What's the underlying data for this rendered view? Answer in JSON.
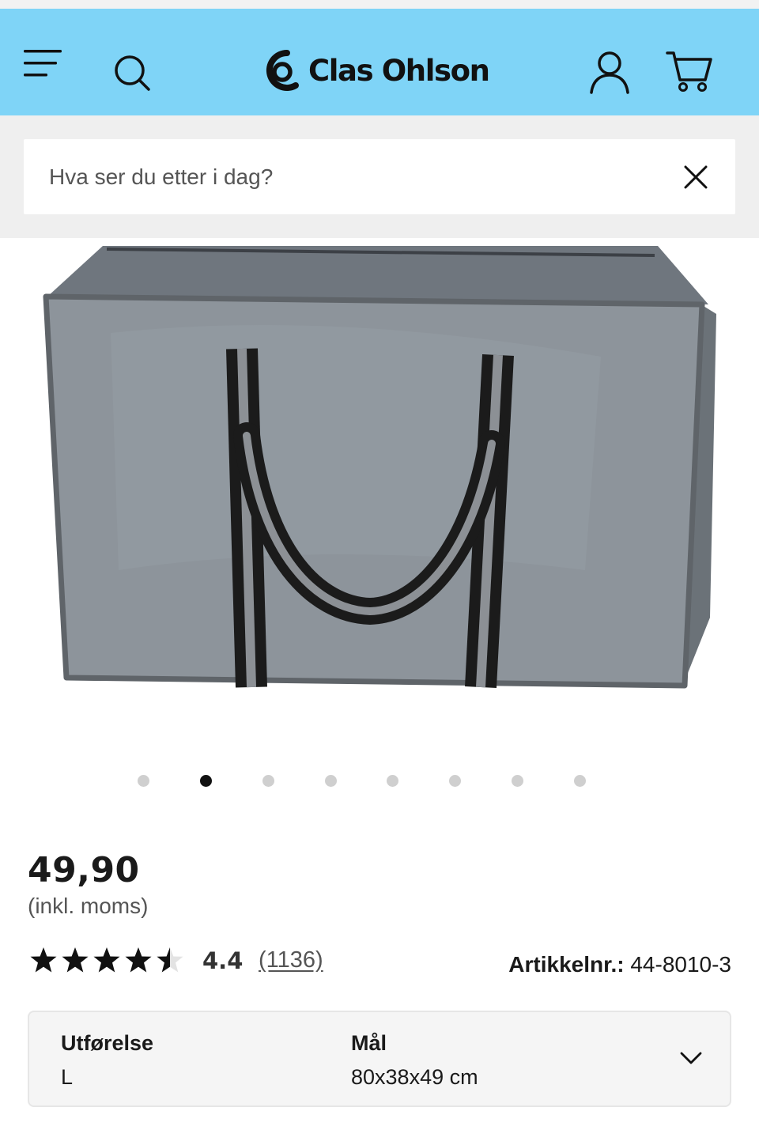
{
  "header": {
    "brand": "Clas Ohlson",
    "icons": [
      "menu-icon",
      "search-icon",
      "clas-ohlson-logo",
      "account-icon",
      "cart-icon"
    ],
    "background_color": "#7fd4f7"
  },
  "search": {
    "placeholder": "Hva ser du etter i dag?",
    "clear_icon": "close-icon"
  },
  "gallery": {
    "image_description": "grey storage bag",
    "slide_count": 8,
    "active_slide": 2
  },
  "product": {
    "price": "49,90",
    "vat_note": "(inkl. moms)",
    "rating": "4.4",
    "rating_value": 4.4,
    "rating_max": 5,
    "review_count": "(1136)",
    "article_label": "Artikkelnr.:",
    "article_number": "44-8010-3"
  },
  "variant": {
    "option1_label": "Utførelse",
    "option1_value": "L",
    "option2_label": "Mål",
    "option2_value": "80x38x49 cm"
  }
}
